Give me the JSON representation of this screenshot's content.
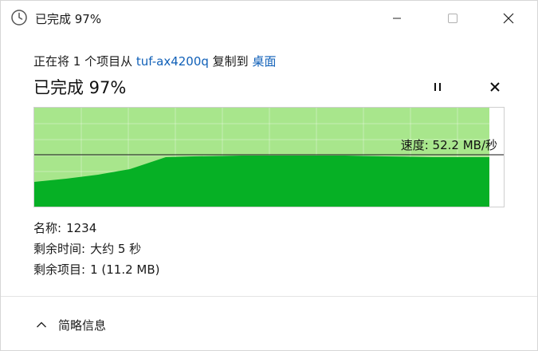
{
  "window": {
    "title": "已完成 97%",
    "icon": "clock-icon"
  },
  "copy_info": {
    "prefix": "正在将 1 个项目从 ",
    "source": "tuf-ax4200q",
    "middle": " 复制到 ",
    "destination": "桌面"
  },
  "progress": {
    "title": "已完成 97%",
    "percent": 97,
    "speed_label": "速度: 52.2 MB/秒"
  },
  "details": {
    "name_label": "名称:",
    "name_value": "1234",
    "time_label": "剩余时间:",
    "time_value": "大约 5 秒",
    "items_label": "剩余项目:",
    "items_value": "1 (11.2 MB)"
  },
  "footer": {
    "toggle_label": "简略信息",
    "toggle_icon": "chevron-up-icon"
  },
  "colors": {
    "graph_light": "#a8e68c",
    "graph_dark": "#06b025",
    "link": "#1060b8"
  }
}
